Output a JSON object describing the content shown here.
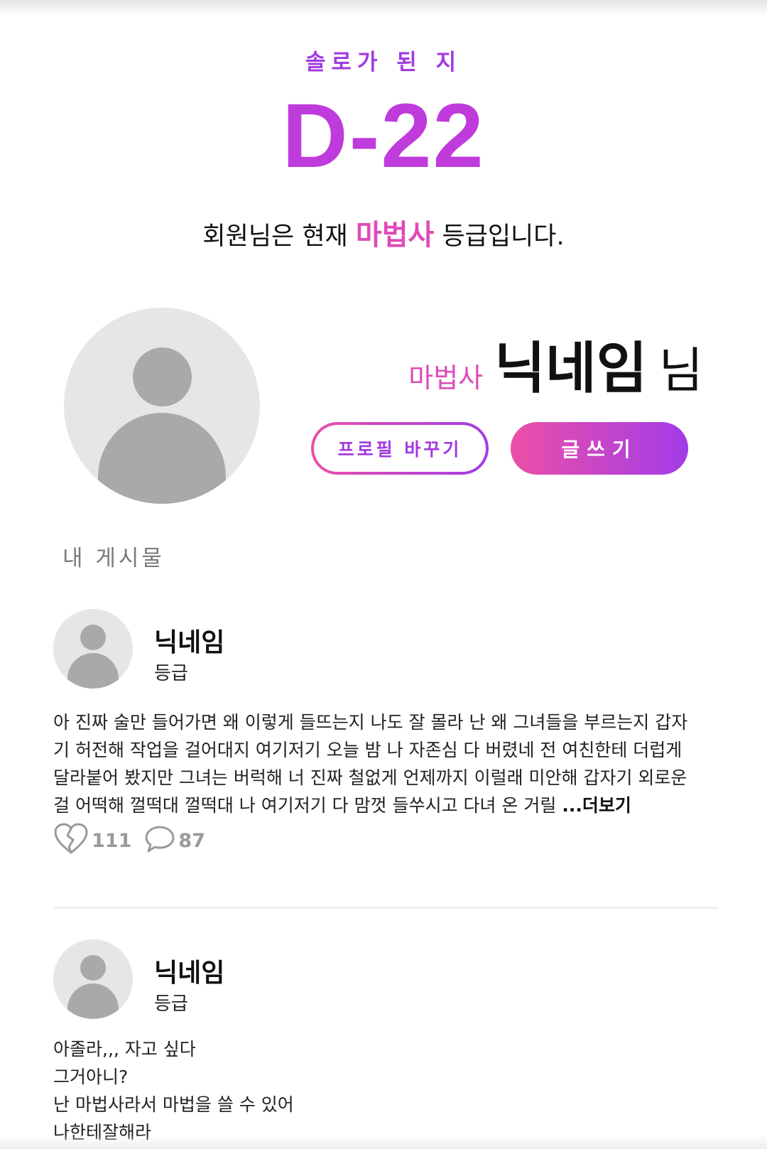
{
  "header": {
    "solo_label": "솔로가 된 지",
    "dday": "D-22",
    "grade_sentence_prefix": "회원님은 현재",
    "grade": "마법사",
    "grade_sentence_suffix": "등급입니다."
  },
  "profile": {
    "grade": "마법사",
    "nickname": "닉네임",
    "suffix": "님",
    "edit_profile_label": "프로필 바꾸기",
    "write_label": "글쓰기"
  },
  "colors": {
    "accent_purple": "#bf3bdb",
    "accent_pink": "#e04ab9",
    "gradient_start": "#ec4fa6",
    "gradient_end": "#a23ce8"
  },
  "my_posts_label": "내 게시물",
  "posts": [
    {
      "nickname": "닉네임",
      "grade": "등급",
      "lines": [
        "아 진짜 술만 들어가면 왜 이렇게 들뜨는지 나도 잘 몰라 난 왜 그녀들을 부르는지 갑자",
        "기 허전해 작업을 걸어대지 여기저기 오늘 밤 나 자존심 다 버렸네 전 여친한테 더럽게",
        "달라붙어 봤지만 그녀는 버럭해 너 진짜 철없게 언제까지 이럴래 미안해 갑자기 외로운",
        "걸 어떡해 껄떡대 껄떡대 나 여기저기 다 맘껏 들쑤시고 다녀 온 거릴"
      ],
      "more_label": "...더보기",
      "likes": "111",
      "comments": "87",
      "like_icon": "broken-heart-icon",
      "comment_icon": "speech-bubble-icon"
    },
    {
      "nickname": "닉네임",
      "grade": "등급",
      "lines": [
        "아졸라,,, 자고 싶다",
        "그거아니?",
        "난 마법사라서 마법을 쓸 수 있어",
        "나한테잘해라"
      ]
    }
  ]
}
